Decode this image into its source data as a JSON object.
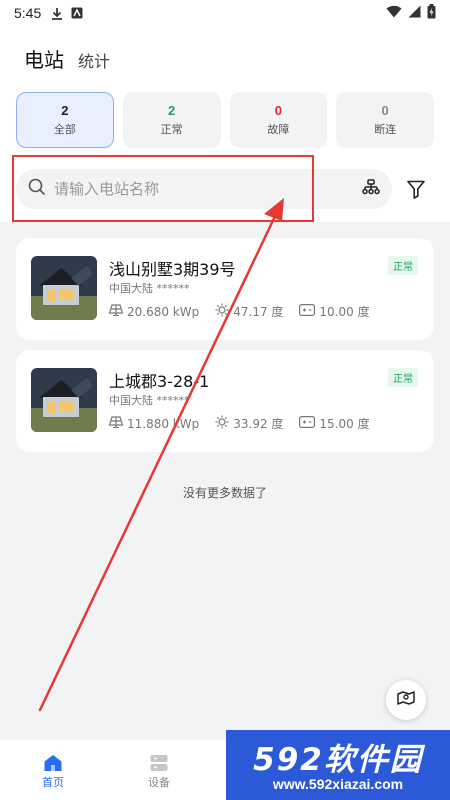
{
  "status_bar": {
    "time": "5:45"
  },
  "header": {
    "active_tab": "电站",
    "inactive_tab": "统计"
  },
  "filters": [
    {
      "count": "2",
      "label": "全部",
      "color": "#222222"
    },
    {
      "count": "2",
      "label": "正常",
      "color": "#1aa55c"
    },
    {
      "count": "0",
      "label": "故障",
      "color": "#e0263c"
    },
    {
      "count": "0",
      "label": "断连",
      "color": "#888888"
    }
  ],
  "search": {
    "placeholder": "请输入电站名称"
  },
  "stations": [
    {
      "name": "浅山别墅3期39号",
      "region": "中国大陆 ******",
      "capacity": "20.680 kWp",
      "energy": "47.17 度",
      "earnings": "10.00 度",
      "status": "正常"
    },
    {
      "name": "上城郡3-28-1",
      "region": "中国大陆 ******",
      "capacity": "11.880 kWp",
      "energy": "33.92 度",
      "earnings": "15.00 度",
      "status": "正常"
    }
  ],
  "list_footer": "没有更多数据了",
  "bottom_nav": [
    {
      "label": "首页"
    },
    {
      "label": "设备"
    }
  ],
  "watermark": {
    "brand": "592软件园",
    "url": "www.592xiazai.com"
  },
  "colors": {
    "accent": "#2a6cf6",
    "highlight": "#e53935",
    "watermark_bg": "#2c59d7"
  }
}
